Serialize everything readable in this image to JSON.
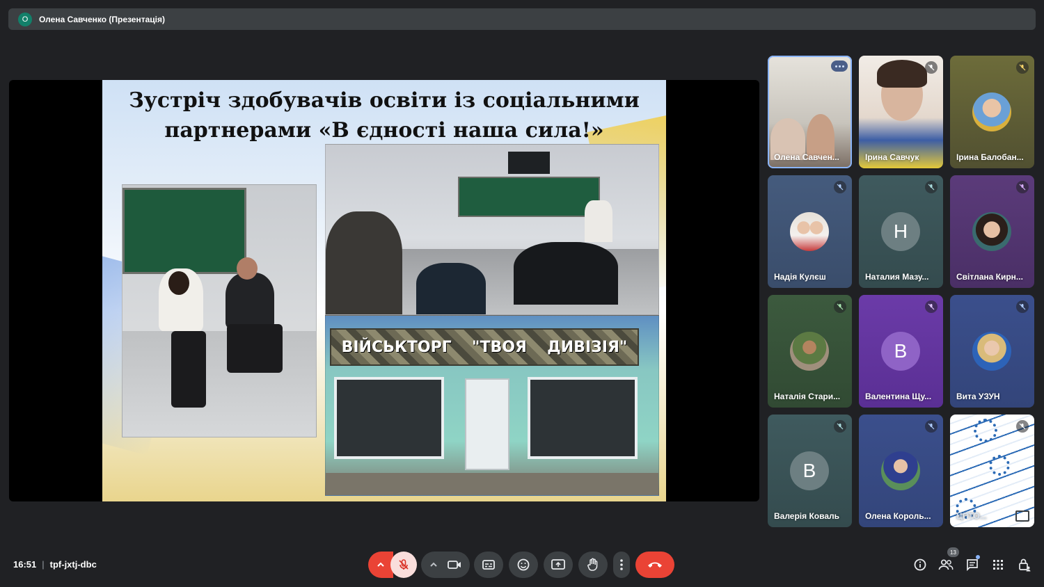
{
  "presenter": {
    "avatar_initial": "О",
    "label": "Олена Савченко (Презентація)"
  },
  "slide": {
    "title_line1": "Зустріч здобувачів освіти із соціальними",
    "title_line2": "партнерами «В єдності наша сила!»",
    "shop_sign_left": "ВІЙСЬКТОРГ",
    "shop_sign_mid": "\"ТВОЯ",
    "shop_sign_right": "ДИВІЗІЯ\""
  },
  "participants": [
    {
      "name": "Олена Савчен...",
      "type": "video",
      "mic": "on",
      "active": true
    },
    {
      "name": "Ірина Савчук",
      "type": "video",
      "mic": "off"
    },
    {
      "name": "Ірина Балобан...",
      "type": "photo",
      "mic": "off"
    },
    {
      "name": "Надія Кулєш",
      "type": "photo",
      "mic": "off"
    },
    {
      "name": "Наталия Мазу...",
      "type": "initial",
      "initial": "Н",
      "mic": "off"
    },
    {
      "name": "Світлана Кирн...",
      "type": "photo",
      "mic": "off"
    },
    {
      "name": "Наталія Стари...",
      "type": "photo",
      "mic": "off"
    },
    {
      "name": "Валентина Щу...",
      "type": "initial",
      "initial": "В",
      "mic": "off"
    },
    {
      "name": "Вита УЗУН",
      "type": "photo",
      "mic": "off"
    },
    {
      "name": "Валерія Коваль",
      "type": "initial",
      "initial": "В",
      "mic": "off"
    },
    {
      "name": "Олена Король...",
      "type": "photo",
      "mic": "off"
    },
    {
      "name": "ЦПТО...",
      "type": "video",
      "mic": "off"
    }
  ],
  "meeting": {
    "time": "16:51",
    "separator": "|",
    "code": "tpf-jxtj-dbc"
  },
  "people_count": "13",
  "colors": {
    "end_call": "#ea4335",
    "control_bg": "#3c4043",
    "accent": "#8ab4f8",
    "bg": "#202124"
  }
}
